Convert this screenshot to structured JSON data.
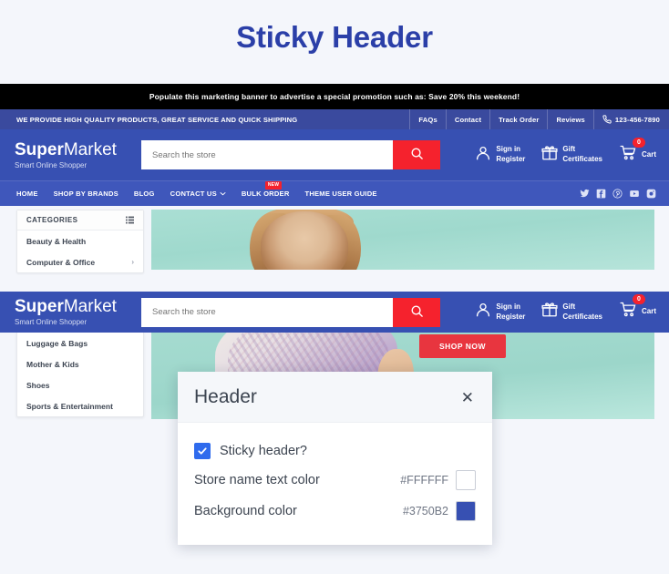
{
  "page": {
    "title": "Sticky Header",
    "title_color": "#2b3fa8",
    "background": "#f4f6fb"
  },
  "promo_banner": {
    "text": "Populate this marketing banner to advertise a special promotion such as: Save 20% this weekend!",
    "background": "#000000",
    "text_color": "#ffffff"
  },
  "utility_bar": {
    "tagline": "WE PROVIDE HIGH QUALITY PRODUCTS, GREAT SERVICE AND QUICK SHIPPING",
    "background": "#3a4a9e",
    "links": [
      "FAQs",
      "Contact",
      "Track Order",
      "Reviews"
    ],
    "phone": "123-456-7890",
    "phone_icon": "phone-icon"
  },
  "header": {
    "background": "#3750B2",
    "brand_name_bold": "Super",
    "brand_name_thin": "Market",
    "brand_tagline": "Smart Online Shopper",
    "search": {
      "placeholder": "Search the store",
      "value": "",
      "button_icon": "search-icon",
      "button_color": "#f5222d"
    },
    "actions": {
      "account_line1": "Sign in",
      "account_line2": "Register",
      "account_icon": "user-icon",
      "gift_line1": "Gift",
      "gift_line2": "Certificates",
      "gift_icon": "gift-icon",
      "cart_label": "Cart",
      "cart_count": "0",
      "cart_icon": "cart-icon"
    }
  },
  "nav": {
    "background": "#3f57bb",
    "items": [
      {
        "label": "HOME",
        "has_caret": false,
        "badge": ""
      },
      {
        "label": "SHOP BY BRANDS",
        "has_caret": false,
        "badge": ""
      },
      {
        "label": "BLOG",
        "has_caret": false,
        "badge": ""
      },
      {
        "label": "CONTACT US",
        "has_caret": true,
        "badge": ""
      },
      {
        "label": "BULK ORDER",
        "has_caret": false,
        "badge": "NEW"
      },
      {
        "label": "THEME USER GUIDE",
        "has_caret": false,
        "badge": ""
      }
    ],
    "social": [
      "twitter-icon",
      "facebook-icon",
      "pinterest-icon",
      "youtube-icon",
      "instagram-icon"
    ]
  },
  "categories": {
    "header_title": "CATEGORIES",
    "header_icon": "grid-list-icon",
    "items_top": [
      {
        "label": "Beauty & Health",
        "chevron": ""
      },
      {
        "label": "Computer & Office",
        "chevron": "›"
      }
    ],
    "items_bottom": [
      {
        "label": "Luggage & Bags",
        "chevron": ""
      },
      {
        "label": "Mother & Kids",
        "chevron": ""
      },
      {
        "label": "Shoes",
        "chevron": ""
      },
      {
        "label": "Sports & Entertainment",
        "chevron": ""
      }
    ]
  },
  "hero": {
    "shop_now_label": "SHOP NOW",
    "shop_now_color": "#e8353f"
  },
  "modal": {
    "title": "Header",
    "close_icon": "close-icon",
    "sticky_header_label": "Sticky header?",
    "sticky_header_checked": true,
    "checkbox_color": "#2f6bed",
    "fields": [
      {
        "label": "Store name text color",
        "value": "#FFFFFF",
        "swatch": "#FFFFFF"
      },
      {
        "label": "Background color",
        "value": "#3750B2",
        "swatch": "#3750B2"
      }
    ]
  }
}
